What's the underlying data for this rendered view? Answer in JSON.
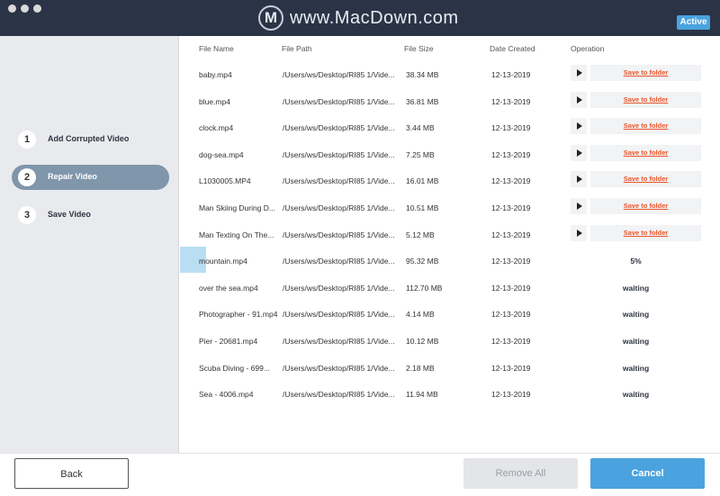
{
  "titlebar": {
    "watermark_logo": "M",
    "watermark_text": "www.MacDown.com",
    "active_badge": "Active"
  },
  "steps": [
    {
      "num": "1",
      "label": "Add Corrupted Video",
      "active": false
    },
    {
      "num": "2",
      "label": "Repair Video",
      "active": true
    },
    {
      "num": "3",
      "label": "Save Video",
      "active": false
    }
  ],
  "table": {
    "headers": {
      "name": "File Name",
      "path": "File Path",
      "size": "File Size",
      "date": "Date Created",
      "operation": "Operation"
    },
    "save_label": "Save to folder",
    "rows": [
      {
        "name": "baby.mp4",
        "path": "/Users/ws/Desktop/RI85 1/Vide...",
        "size": "38.34 MB",
        "date": "12-13-2019",
        "status": "done"
      },
      {
        "name": "blue.mp4",
        "path": "/Users/ws/Desktop/RI85 1/Vide...",
        "size": "36.81 MB",
        "date": "12-13-2019",
        "status": "done"
      },
      {
        "name": "clock.mp4",
        "path": "/Users/ws/Desktop/RI85 1/Vide...",
        "size": "3.44 MB",
        "date": "12-13-2019",
        "status": "done"
      },
      {
        "name": "dog-sea.mp4",
        "path": "/Users/ws/Desktop/RI85 1/Vide...",
        "size": "7.25 MB",
        "date": "12-13-2019",
        "status": "done"
      },
      {
        "name": "L1030005.MP4",
        "path": "/Users/ws/Desktop/RI85 1/Vide...",
        "size": "16.01 MB",
        "date": "12-13-2019",
        "status": "done"
      },
      {
        "name": "Man Skiing During D...",
        "path": "/Users/ws/Desktop/RI85 1/Vide...",
        "size": "10.51 MB",
        "date": "12-13-2019",
        "status": "done"
      },
      {
        "name": "Man Texting On The...",
        "path": "/Users/ws/Desktop/RI85 1/Vide...",
        "size": "5.12 MB",
        "date": "12-13-2019",
        "status": "done"
      },
      {
        "name": "mountain.mp4",
        "path": "/Users/ws/Desktop/RI85 1/Vide...",
        "size": "95.32 MB",
        "date": "12-13-2019",
        "status": "5%"
      },
      {
        "name": "over the sea.mp4",
        "path": "/Users/ws/Desktop/RI85 1/Vide...",
        "size": "112.70 MB",
        "date": "12-13-2019",
        "status": "waiting"
      },
      {
        "name": "Photographer - 91.mp4",
        "path": "/Users/ws/Desktop/RI85 1/Vide...",
        "size": "4.14 MB",
        "date": "12-13-2019",
        "status": "waiting"
      },
      {
        "name": "Pier - 20681.mp4",
        "path": "/Users/ws/Desktop/RI85 1/Vide...",
        "size": "10.12 MB",
        "date": "12-13-2019",
        "status": "waiting"
      },
      {
        "name": "Scuba Diving - 699...",
        "path": "/Users/ws/Desktop/RI85 1/Vide...",
        "size": "2.18 MB",
        "date": "12-13-2019",
        "status": "waiting"
      },
      {
        "name": "Sea - 4006.mp4",
        "path": "/Users/ws/Desktop/RI85 1/Vide...",
        "size": "11.94 MB",
        "date": "12-13-2019",
        "status": "waiting"
      }
    ]
  },
  "footer": {
    "back_label": "Back",
    "remove_all_label": "Remove All",
    "cancel_label": "Cancel"
  },
  "colors": {
    "titlebar": "#2b3447",
    "accent": "#4aa3df",
    "active_step": "#7f96ab",
    "save_link": "#e8562d"
  }
}
